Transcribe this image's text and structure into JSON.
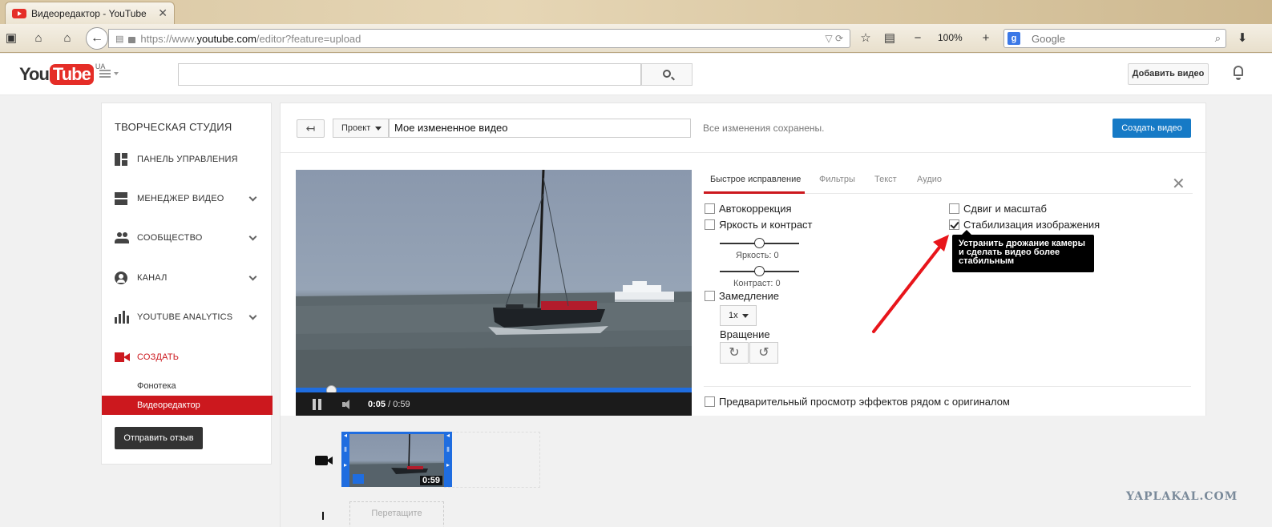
{
  "browser": {
    "tab_title": "Видеоредактор - YouTube",
    "url_prefix": "https://www.",
    "url_host": "youtube.com",
    "url_path": "/editor?feature=upload",
    "zoom": "100%",
    "search_placeholder": "Google",
    "search_engine_letter": "g"
  },
  "header": {
    "logo_you": "You",
    "logo_tube": "Tube",
    "logo_region": "UA",
    "upload_label": "Добавить видео"
  },
  "sidebar": {
    "title": "ТВОРЧЕСКАЯ СТУДИЯ",
    "items": [
      {
        "label": "ПАНЕЛЬ УПРАВЛЕНИЯ",
        "icon": "dashboard-icon"
      },
      {
        "label": "МЕНЕДЖЕР ВИДЕО",
        "icon": "video-manager-icon"
      },
      {
        "label": "СООБЩЕСТВО",
        "icon": "community-icon"
      },
      {
        "label": "КАНАЛ",
        "icon": "channel-icon"
      },
      {
        "label": "YOUTUBE ANALYTICS",
        "icon": "analytics-icon"
      },
      {
        "label": "СОЗДАТЬ",
        "icon": "create-camera-icon"
      }
    ],
    "subitems": [
      {
        "label": "Фонотека",
        "selected": false
      },
      {
        "label": "Видеоредактор",
        "selected": true
      }
    ],
    "feedback_label": "Отправить отзыв"
  },
  "editor": {
    "project_dropdown": "Проект",
    "project_name": "Мое измененное видео",
    "saved_status": "Все изменения сохранены.",
    "create_label": "Создать видео",
    "player": {
      "current_time": "0:05",
      "duration": "/ 0:59",
      "progress": 0.09
    },
    "tabs": [
      "Быстрое исправление",
      "Фильтры",
      "Текст",
      "Аудио"
    ],
    "active_tab": "Быстрое исправление",
    "options": {
      "autocorrect": "Автокоррекция",
      "brightness_contrast": "Яркость и контраст",
      "brightness_label": "Яркость: 0",
      "contrast_label": "Контраст: 0",
      "slowmo": "Замедление",
      "speed": "1x",
      "rotation": "Вращение",
      "pan_zoom": "Сдвиг и масштаб",
      "stabilize": "Стабилизация изображения",
      "stabilize_checked": true,
      "preview": "Предварительный просмотр эффектов рядом с оригиналом"
    },
    "tooltip": "Устранить дрожание камеры и сделать видео более стабильным",
    "timeline": {
      "clip_duration": "0:59",
      "drop_hint": "Перетащите"
    }
  },
  "watermark": "YAPLAKAL.COM",
  "colors": {
    "youtube_red": "#cc181e",
    "accent_blue": "#167ac6",
    "arrow_red": "#e8151b"
  }
}
